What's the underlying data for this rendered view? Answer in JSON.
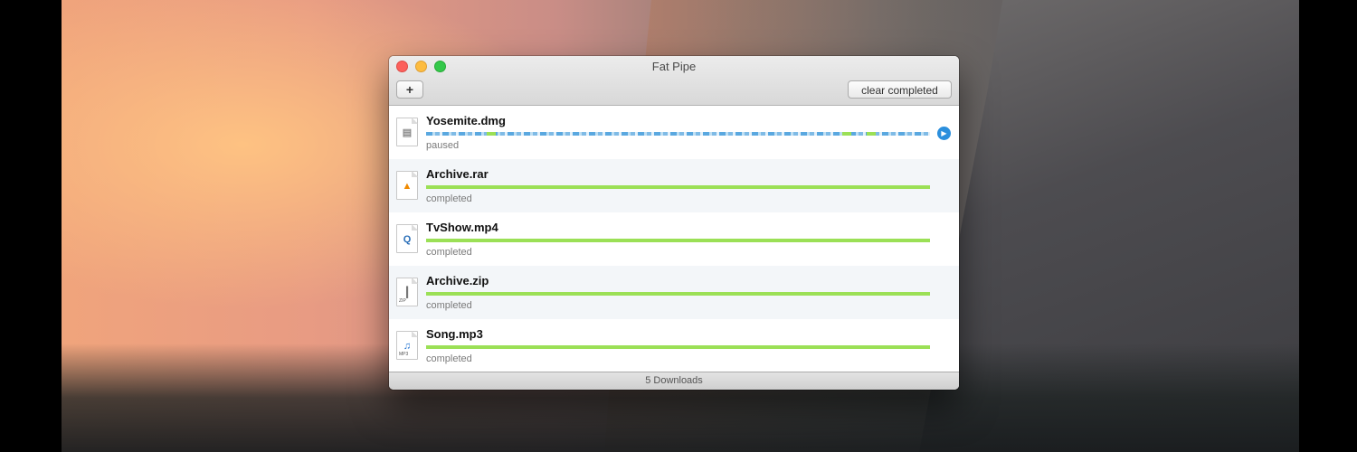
{
  "window": {
    "title": "Fat Pipe",
    "add_label": "+",
    "clear_label": "clear completed"
  },
  "downloads": [
    {
      "name": "Yosemite.dmg",
      "status": "paused",
      "progress": 1.0,
      "icon": "disk-image-icon",
      "glyph": "▤",
      "glyph_color": "#888888"
    },
    {
      "name": "Archive.rar",
      "status": "completed",
      "progress": 1.0,
      "icon": "vlc-cone-icon",
      "glyph": "▲",
      "glyph_color": "#f08a00"
    },
    {
      "name": "TvShow.mp4",
      "status": "completed",
      "progress": 1.0,
      "icon": "quicktime-icon",
      "glyph": "Q",
      "glyph_color": "#2a6fb8"
    },
    {
      "name": "Archive.zip",
      "status": "completed",
      "progress": 1.0,
      "icon": "zip-archive-icon",
      "glyph": "┃",
      "glyph_color": "#777777",
      "tag": "ZIP"
    },
    {
      "name": "Song.mp3",
      "status": "completed",
      "progress": 1.0,
      "icon": "music-file-icon",
      "glyph": "♫",
      "glyph_color": "#1d6fd0",
      "tag": "MP3"
    }
  ],
  "resume_icon": "▶",
  "footer": {
    "count_label": "5 Downloads"
  },
  "colors": {
    "progress_complete": "#9be056",
    "progress_active": "#5aa8e0",
    "resume_button": "#2b8fdd"
  }
}
